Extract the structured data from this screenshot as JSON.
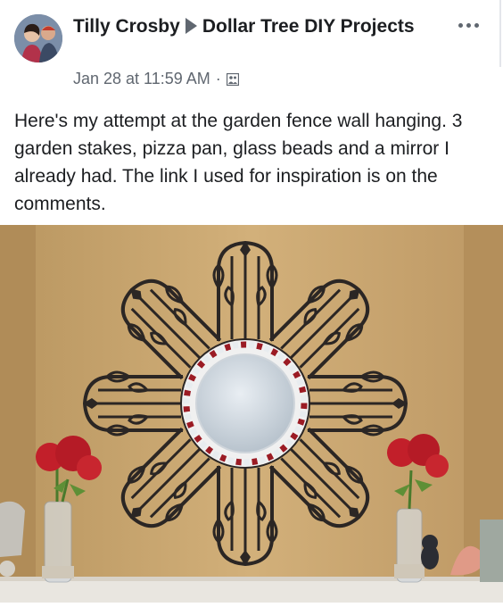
{
  "post": {
    "author": "Tilly Crosby",
    "group": "Dollar Tree DIY Projects",
    "timestamp": "Jan 28 at 11:59 AM",
    "separator": "·",
    "audience_icon": "group-audience-icon",
    "text": "Here's my attempt at the garden fence wall hanging. 3 garden stakes, pizza pan, glass beads and a mirror I already had. The link I used for inspiration is on the comments."
  },
  "icons": {
    "more": "more-options-icon",
    "arrow": "share-arrow-icon"
  },
  "colors": {
    "wall": "#c9a772",
    "metal": "#2b2624",
    "bead_red": "#9b1b24",
    "bead_white": "#e8ecef",
    "flowers": "#c21f2a"
  }
}
